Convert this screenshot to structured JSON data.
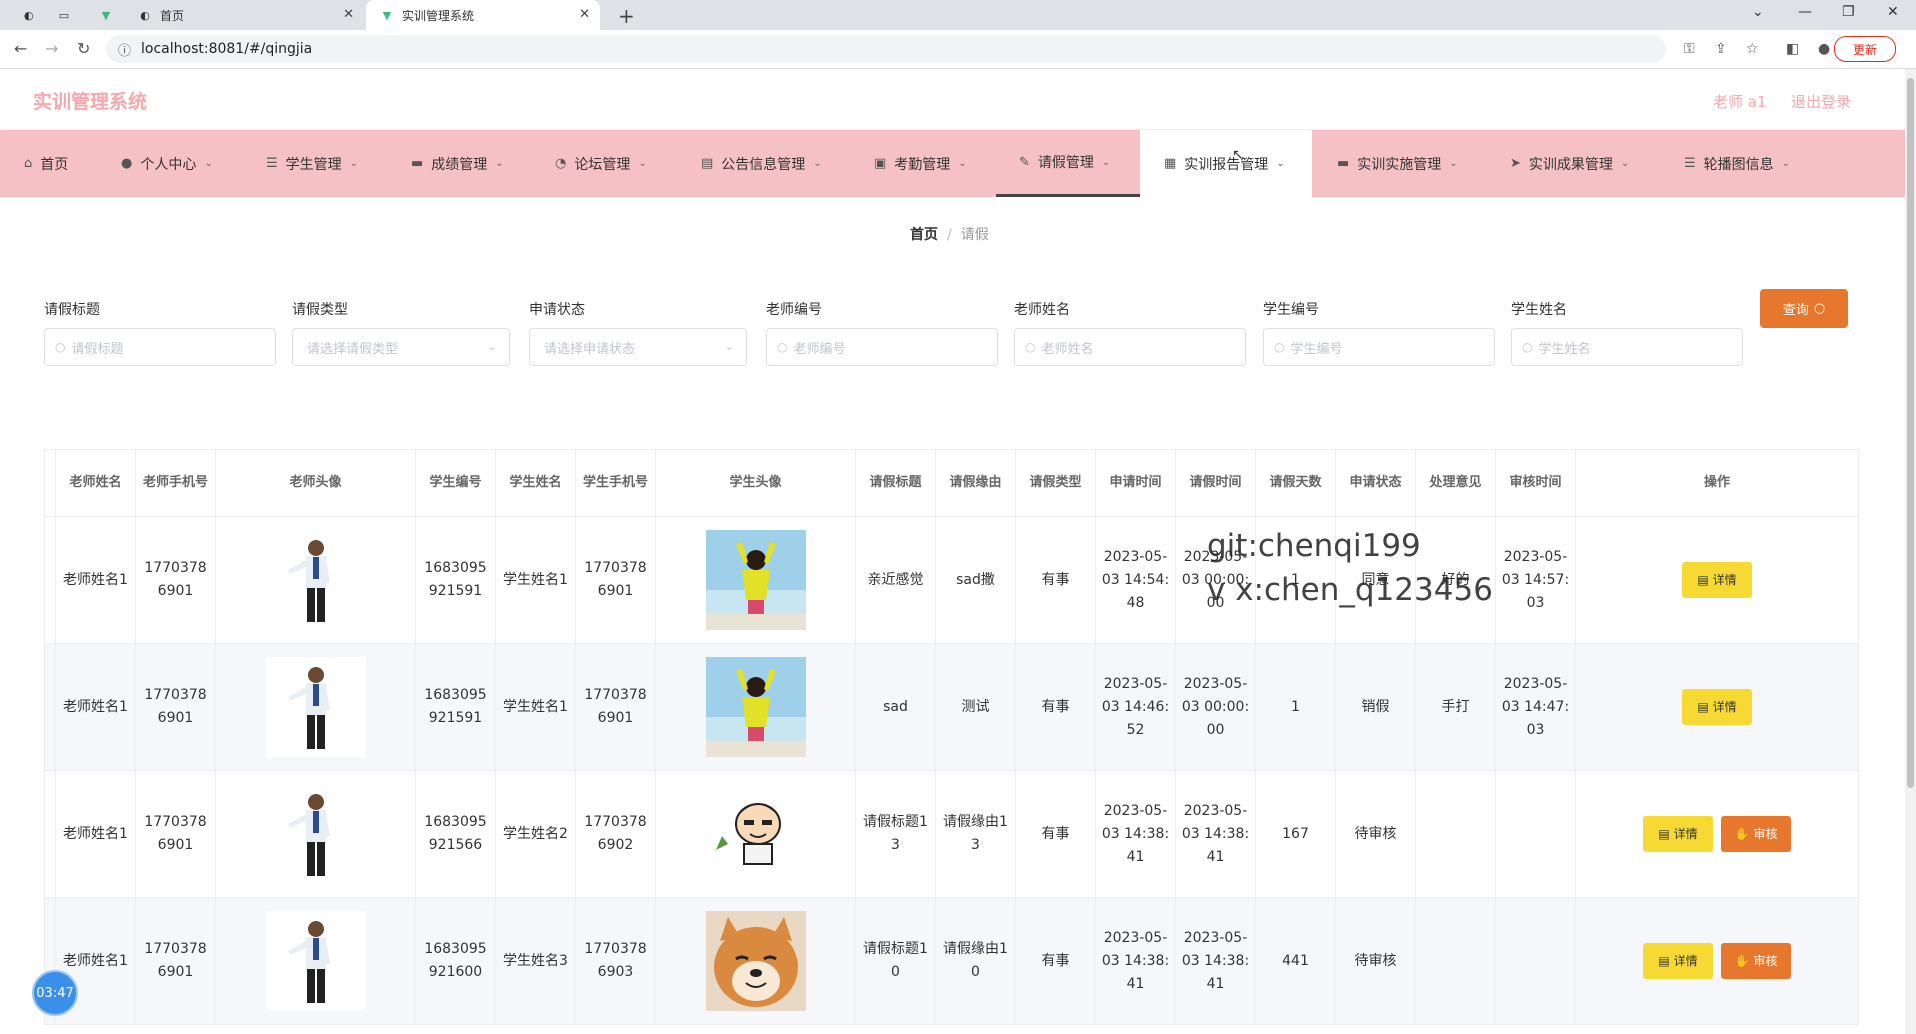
{
  "browser": {
    "tabs": [
      {
        "title": "",
        "icon": "globe-icon"
      },
      {
        "title": "",
        "icon": "blank-icon"
      },
      {
        "title": "",
        "icon": "vue-icon"
      },
      {
        "title": "首页",
        "icon": "globe-icon"
      },
      {
        "title": "实训管理系统",
        "icon": "vue-icon"
      }
    ],
    "url": "localhost:8081/#/qingjia",
    "update_label": "更新"
  },
  "header": {
    "logo": "实训管理系统",
    "user": "老师 a1",
    "logout": "退出登录"
  },
  "menu": [
    {
      "label": "首页",
      "icon": "home-icon"
    },
    {
      "label": "个人中心",
      "icon": "user-icon"
    },
    {
      "label": "学生管理",
      "icon": "list-icon"
    },
    {
      "label": "成绩管理",
      "icon": "monitor-icon"
    },
    {
      "label": "论坛管理",
      "icon": "compass-icon"
    },
    {
      "label": "公告信息管理",
      "icon": "document-icon"
    },
    {
      "label": "考勤管理",
      "icon": "check-icon"
    },
    {
      "label": "请假管理",
      "icon": "brush-icon"
    },
    {
      "label": "实训报告管理",
      "icon": "grid-icon"
    },
    {
      "label": "实训实施管理",
      "icon": "box-icon"
    },
    {
      "label": "实训成果管理",
      "icon": "send-icon"
    },
    {
      "label": "轮播图信息",
      "icon": "menu-icon"
    }
  ],
  "breadcrumb": {
    "home": "首页",
    "sep": "/",
    "current": "请假"
  },
  "filters": [
    {
      "label": "请假标题",
      "placeholder": "请假标题",
      "type": "input"
    },
    {
      "label": "请假类型",
      "placeholder": "请选择请假类型",
      "type": "select"
    },
    {
      "label": "申请状态",
      "placeholder": "请选择申请状态",
      "type": "select"
    },
    {
      "label": "老师编号",
      "placeholder": "老师编号",
      "type": "input"
    },
    {
      "label": "老师姓名",
      "placeholder": "老师姓名",
      "type": "input"
    },
    {
      "label": "学生编号",
      "placeholder": "学生编号",
      "type": "input"
    },
    {
      "label": "学生姓名",
      "placeholder": "学生姓名",
      "type": "input"
    }
  ],
  "query_label": "查询",
  "table": {
    "columns": [
      "老师姓名",
      "老师手机号",
      "老师头像",
      "学生编号",
      "学生姓名",
      "学生手机号",
      "学生头像",
      "请假标题",
      "请假缘由",
      "请假类型",
      "申请时间",
      "请假时间",
      "请假天数",
      "申请状态",
      "处理意见",
      "审核时间",
      "操作"
    ],
    "rows": [
      {
        "teacher_name": "老师姓名1",
        "teacher_phone": "17703786901",
        "student_no": "1683095921591",
        "student_name": "学生姓名1",
        "student_phone": "17703786901",
        "student_avatar": "girl-photo",
        "title": "亲近感觉",
        "reason": "sad撒",
        "type": "有事",
        "apply_time": "2023-05-03 14:54:48",
        "leave_time": "2023-05-03 00:00:00",
        "days": "1",
        "status": "同意",
        "opinion": "好的",
        "audit_time": "2023-05-03 14:57:03",
        "actions": [
          "详情"
        ]
      },
      {
        "teacher_name": "老师姓名1",
        "teacher_phone": "17703786901",
        "student_no": "1683095921591",
        "student_name": "学生姓名1",
        "student_phone": "17703786901",
        "student_avatar": "girl-photo",
        "title": "sad",
        "reason": "测试",
        "type": "有事",
        "apply_time": "2023-05-03 14:46:52",
        "leave_time": "2023-05-03 00:00:00",
        "days": "1",
        "status": "销假",
        "opinion": "手打",
        "audit_time": "2023-05-03 14:47:03",
        "actions": [
          "详情"
        ]
      },
      {
        "teacher_name": "老师姓名1",
        "teacher_phone": "17703786901",
        "student_no": "1683095921566",
        "student_name": "学生姓名2",
        "student_phone": "17703786902",
        "student_avatar": "cartoon-boy",
        "title": "请假标题13",
        "reason": "请假缘由13",
        "type": "有事",
        "apply_time": "2023-05-03 14:38:41",
        "leave_time": "2023-05-03 14:38:41",
        "days": "167",
        "status": "待审核",
        "opinion": "",
        "audit_time": "",
        "actions": [
          "详情",
          "审核"
        ]
      },
      {
        "teacher_name": "老师姓名1",
        "teacher_phone": "17703786901",
        "student_no": "1683095921600",
        "student_name": "学生姓名3",
        "student_phone": "17703786903",
        "student_avatar": "shiba-dog",
        "title": "请假标题10",
        "reason": "请假缘由10",
        "type": "有事",
        "apply_time": "2023-05-03 14:38:41",
        "leave_time": "2023-05-03 14:38:41",
        "days": "441",
        "status": "待审核",
        "opinion": "",
        "audit_time": "",
        "actions": [
          "详情",
          "审核"
        ]
      }
    ]
  },
  "watermark": [
    "git:chenqi199",
    "v x:chen_q123456"
  ],
  "clock": "03:47",
  "colors": {
    "accent": "#f6c1c4",
    "logo": "#f3a8ac",
    "query": "#e8772e",
    "detail": "#f7d934",
    "audit": "#e8772e"
  }
}
